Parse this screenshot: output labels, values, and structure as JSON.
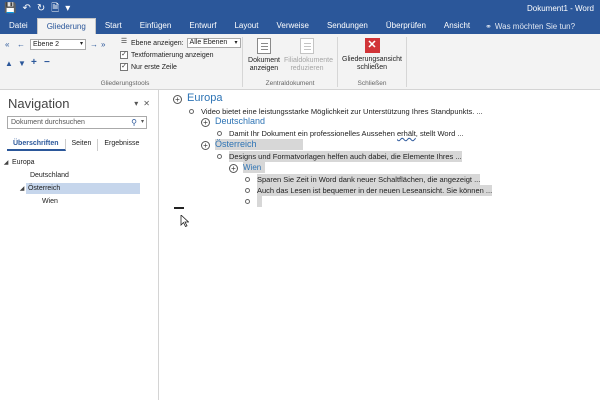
{
  "titlebar": {
    "doc_title": "Dokument1 - Word",
    "qat": [
      "save-icon",
      "undo-icon",
      "redo-icon",
      "print-preview-icon",
      "customize-icon"
    ]
  },
  "tabs": [
    "Datei",
    "Gliederung",
    "Start",
    "Einfügen",
    "Entwurf",
    "Layout",
    "Verweise",
    "Sendungen",
    "Überprüfen",
    "Ansicht"
  ],
  "active_tab": "Gliederung",
  "tellme_placeholder": "Was möchten Sie tun?",
  "ribbon": {
    "level_value": "Ebene 2",
    "show_level_label": "Ebene anzeigen:",
    "show_level_value": "Alle Ebenen",
    "text_format_label": "Textformatierung anzeigen",
    "first_line_label": "Nur erste Zeile",
    "text_format_checked": true,
    "first_line_checked": true,
    "group_outline_tools": "Gliederungstools",
    "show_document_label": "Dokument anzeigen",
    "collapse_subdocs_label": "Filialdokumente reduzieren",
    "group_master_doc": "Zentraldokument",
    "close_outline_label": "Gliederungsansicht schließen",
    "group_close": "Schließen"
  },
  "navigation": {
    "title": "Navigation",
    "search_placeholder": "Dokument durchsuchen",
    "tabs": [
      "Überschriften",
      "Seiten",
      "Ergebnisse"
    ],
    "active_tab": "Überschriften",
    "tree": [
      {
        "label": "Europa",
        "level": 1,
        "expanded": true
      },
      {
        "label": "Deutschland",
        "level": 2
      },
      {
        "label": "Österreich",
        "level": 2,
        "expanded": true,
        "selected": true
      },
      {
        "label": "Wien",
        "level": 3
      }
    ]
  },
  "document": {
    "h1": "Europa",
    "l1_text": "Video bietet eine leistungsstarke Möglichkeit zur Unterstützung Ihres Standpunkts. ...",
    "h2a": "Deutschland",
    "l2a_text_before": "Damit Ihr Dokument ein professionelles Aussehen ",
    "l2a_text_squiggle": "erhält",
    "l2a_text_after": ", stellt Word ...",
    "h2b": "Österreich",
    "l2b_text": "Designs und Formatvorlagen helfen auch dabei, die Elemente Ihres ...",
    "h3": "Wien",
    "l3_text1": "Sparen Sie Zeit in Word dank neuer Schaltflächen, die angezeigt ...",
    "l3_text2": "Auch das Lesen ist bequemer in der neuen Leseansicht. Sie können ..."
  }
}
